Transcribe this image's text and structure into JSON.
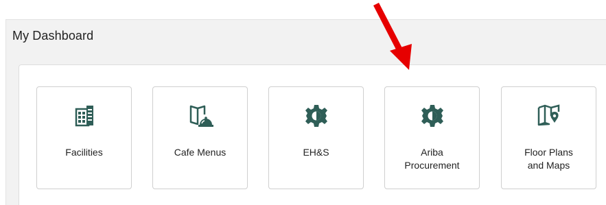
{
  "dashboard": {
    "title": "My Dashboard"
  },
  "tiles": [
    {
      "label": "Facilities",
      "icon": "building-icon"
    },
    {
      "label": "Cafe Menus",
      "icon": "menu-cloche-icon"
    },
    {
      "label": "EH&S",
      "icon": "gear-icon"
    },
    {
      "label": "Ariba\nProcurement",
      "icon": "gear-icon"
    },
    {
      "label": "Floor Plans\nand Maps",
      "icon": "map-pin-icon"
    }
  ],
  "colors": {
    "icon": "#2f5e57",
    "annotation_arrow": "#e60000"
  }
}
